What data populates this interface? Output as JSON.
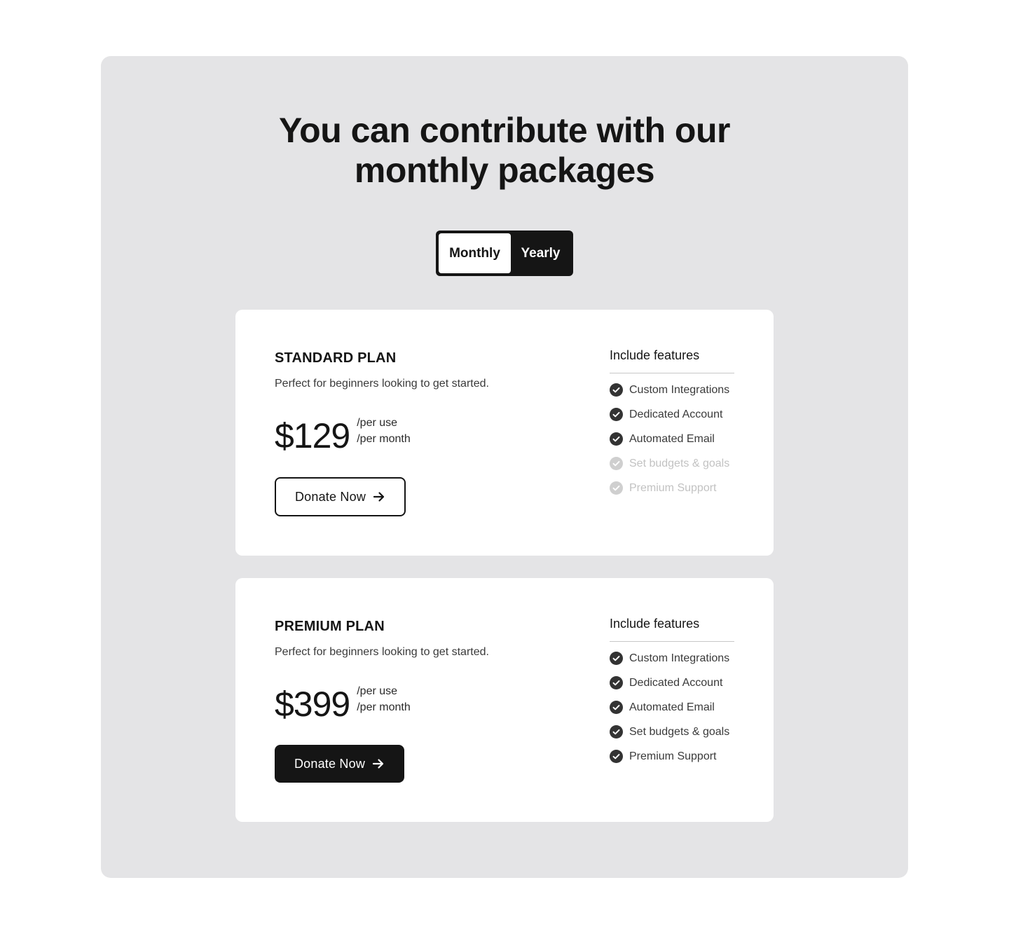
{
  "header": {
    "title_line1": "You can contribute with our",
    "title_line2": "monthly packages"
  },
  "billing_toggle": {
    "monthly_label": "Monthly",
    "yearly_label": "Yearly",
    "selected": "Monthly"
  },
  "plans": [
    {
      "name": "STANDARD PLAN",
      "description": "Perfect for beginners looking to get started.",
      "price": "$129",
      "price_note_1": "/per use",
      "price_note_2": "/per month",
      "button_label": "Donate Now",
      "button_style": "outline",
      "features_title": "Include features",
      "features": [
        {
          "label": "Custom Integrations",
          "included": true
        },
        {
          "label": "Dedicated Account",
          "included": true
        },
        {
          "label": "Automated Email",
          "included": true
        },
        {
          "label": "Set budgets & goals",
          "included": false
        },
        {
          "label": "Premium Support",
          "included": false
        }
      ]
    },
    {
      "name": "PREMIUM PLAN",
      "description": "Perfect for beginners looking to get started.",
      "price": "$399",
      "price_note_1": "/per use",
      "price_note_2": "/per month",
      "button_label": "Donate Now",
      "button_style": "filled",
      "features_title": "Include features",
      "features": [
        {
          "label": "Custom Integrations",
          "included": true
        },
        {
          "label": "Dedicated Account",
          "included": true
        },
        {
          "label": "Automated Email",
          "included": true
        },
        {
          "label": "Set budgets & goals",
          "included": true
        },
        {
          "label": "Premium Support",
          "included": true
        }
      ]
    }
  ],
  "colors": {
    "panel_bg": "#e4e4e6",
    "dark": "#151515",
    "check_included": "#333333",
    "check_excluded": "#cfcfcf"
  },
  "icons": {
    "button_icon": "arrow-right-icon",
    "feature_icon": "check-circle-icon"
  }
}
